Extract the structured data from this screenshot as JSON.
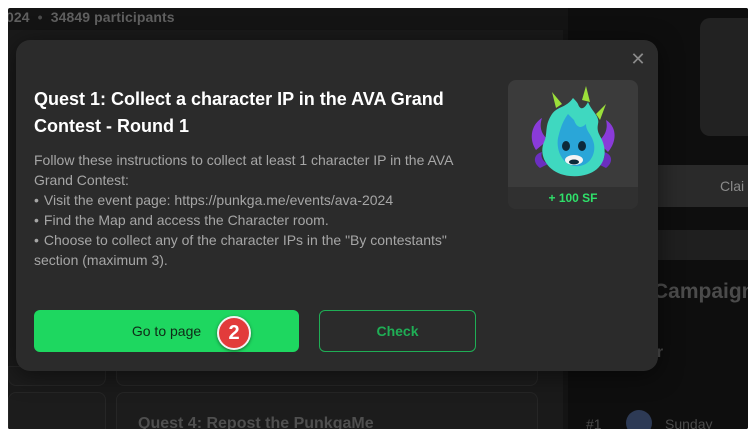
{
  "background": {
    "header": {
      "year_fragment": "024",
      "participants": "34849 participants"
    },
    "claim_label": "Clai",
    "campaign_label": "Campaign",
    "ranking_label": "er",
    "rank_number": "#1",
    "rank_user": "Sunday",
    "quest4_title": "Quest 4: Repost the PunkgaMe"
  },
  "modal": {
    "title": "Quest 1: Collect a character IP in the AVA Grand Contest - Round 1",
    "intro": "Follow these instructions to collect at least 1 character IP in the AVA Grand Contest:",
    "steps": [
      "Visit the event page: https://punkga.me/events/ava-2024",
      "Find the Map and access the Character room.",
      "Choose to collect any of the character IPs in the \"By contestants\" section (maximum 3)."
    ],
    "reward": {
      "label": "+ 100 SF",
      "icon": "character-flame-icon"
    },
    "buttons": {
      "go_to_page": "Go to page",
      "check": "Check"
    },
    "close_icon": "close-icon"
  },
  "annotation": {
    "step_number": "2",
    "color": "#e23b3b"
  },
  "colors": {
    "accent": "#1ed760",
    "reward_text": "#2fe06a",
    "modal_bg": "#2b2b2b"
  }
}
